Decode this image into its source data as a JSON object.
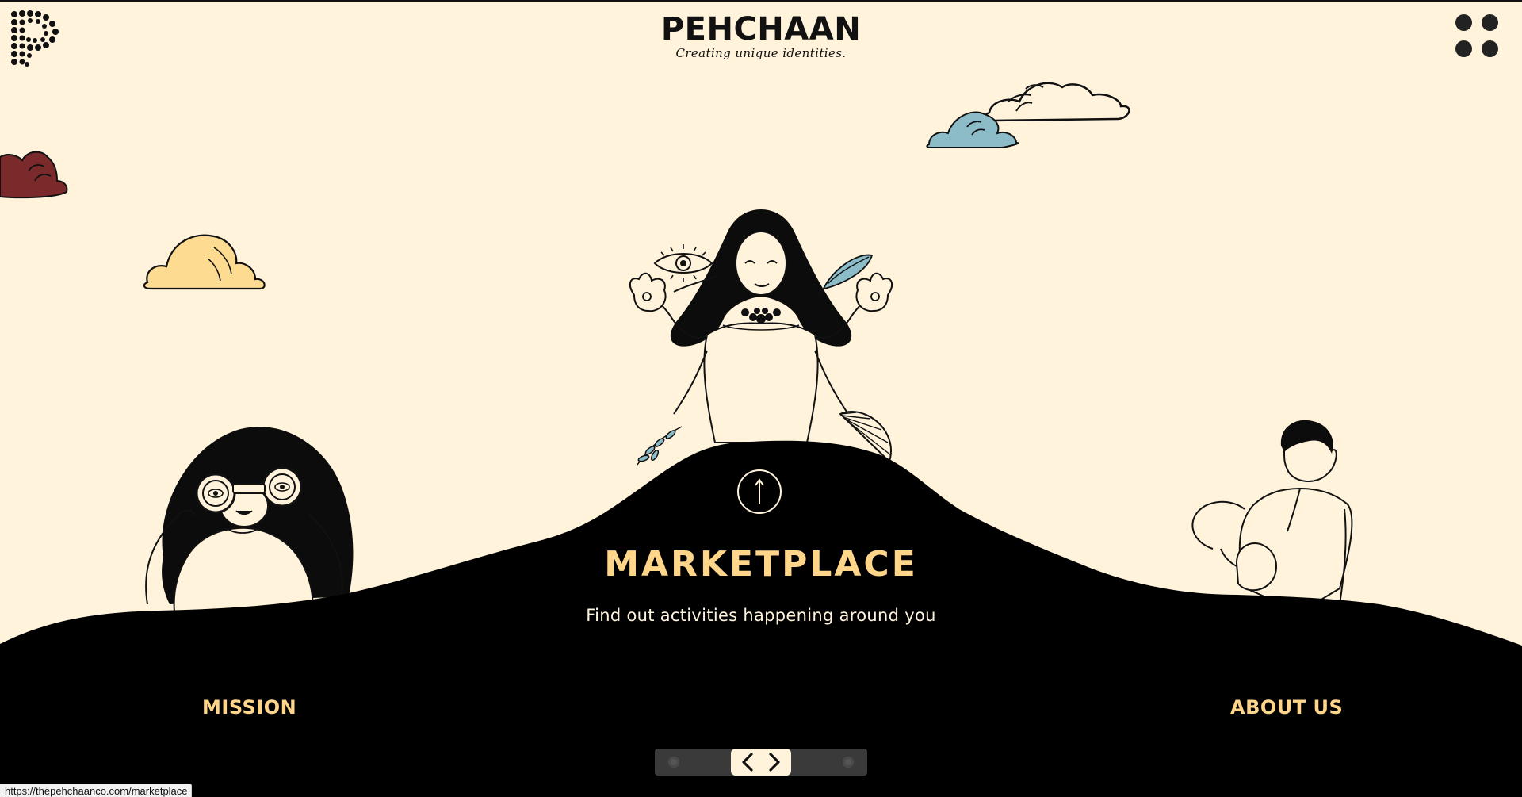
{
  "brand": {
    "title": "PEHCHAAN",
    "tagline": "Creating unique identities."
  },
  "hero": {
    "section_title": "MARKETPLACE",
    "section_description": "Find out activities happening around you"
  },
  "nav": {
    "left_link": "MISSION",
    "right_link": "ABOUT US"
  },
  "pager": {
    "total_positions": 3,
    "active_index": 1
  },
  "status_bar": {
    "url": "https://thepehchaanco.com/marketplace"
  },
  "colors": {
    "background": "#fff3dc",
    "hill": "#000000",
    "accent_yellow": "#ffd58a",
    "cloud_blue": "#8bbcc8",
    "cloud_red": "#7a2a2a",
    "cloud_yellow": "#fddc92"
  },
  "icons": {
    "logo": "dotted-p-logo",
    "menu": "four-dots-menu-icon",
    "up": "arrow-up-icon",
    "prev": "chevron-left-icon",
    "next": "chevron-right-icon"
  }
}
